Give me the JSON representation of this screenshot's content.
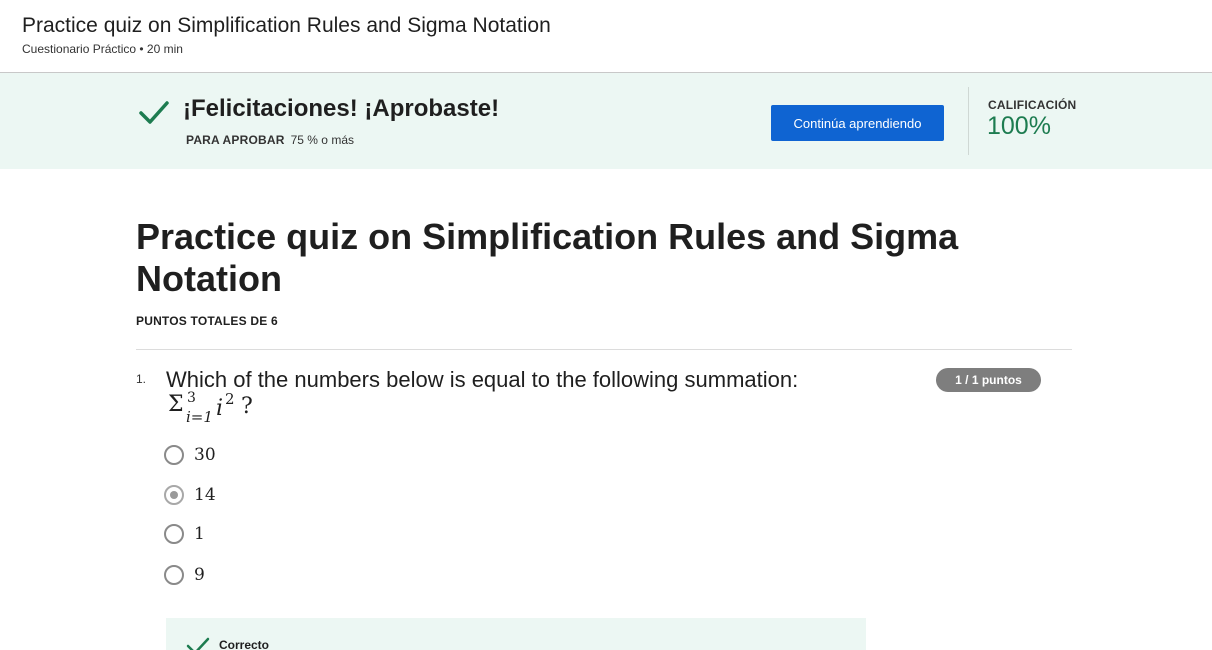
{
  "header": {
    "title": "Practice quiz on Simplification Rules and Sigma Notation",
    "meta": "Cuestionario Práctico • 20 min"
  },
  "banner": {
    "congrats": "¡Felicitaciones! ¡Aprobaste!",
    "pass_label": "PARA APROBAR",
    "pass_value": "75 % o más",
    "continue_label": "Continúa aprendiendo",
    "grade_label": "CALIFICACIÓN",
    "grade_value": "100%",
    "accent_color": "#1d7c50",
    "button_color": "#0f64d2",
    "background_color": "#ecf7f3"
  },
  "main": {
    "title": "Practice quiz on Simplification Rules and Sigma Notation",
    "total_points": "PUNTOS TOTALES DE 6"
  },
  "question": {
    "number": "1.",
    "text": "Which of the numbers below is equal to the following summation:",
    "math": {
      "sigma": "Σ",
      "upper": "3",
      "lower": "i=1",
      "variable": "i",
      "exponent": "2",
      "suffix": "?"
    },
    "points": "1 / 1 puntos",
    "options": [
      {
        "label": "30",
        "selected": false
      },
      {
        "label": "14",
        "selected": true
      },
      {
        "label": "1",
        "selected": false
      },
      {
        "label": "9",
        "selected": false
      }
    ],
    "feedback": "Correcto"
  },
  "icons": {
    "banner_check": "check-icon",
    "feedback_check": "check-icon"
  }
}
